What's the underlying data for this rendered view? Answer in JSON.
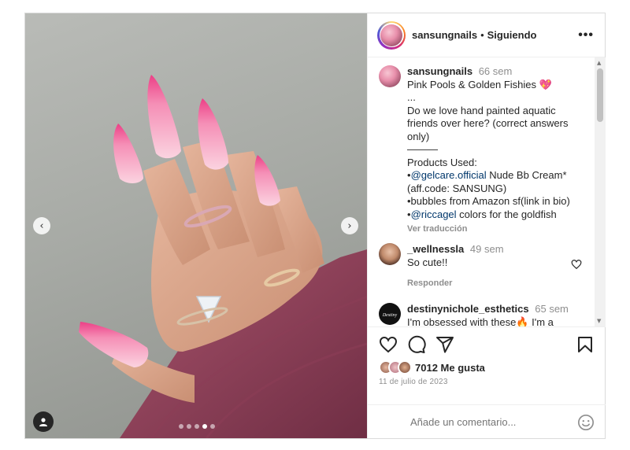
{
  "post": {
    "image_alt": "Hand with long pink almond nails",
    "carousel": {
      "total": 5,
      "active_index": 3
    },
    "nav_prev": "‹",
    "nav_next": "›"
  },
  "header": {
    "username": "sansungnails",
    "separator": "•",
    "follow_state": "Siguiendo",
    "more": "•••"
  },
  "caption": {
    "username": "sansungnails",
    "time": "66 sem",
    "title": "Pink Pools & Golden Fishies",
    "emoji": "💖",
    "lines": [
      "...",
      "Do we love hand painted aquatic",
      "friends over here? (correct answers",
      "only)",
      "———",
      "Products Used:"
    ],
    "product1_prefix": "•",
    "product1_mention": "@gelcare.official",
    "product1_rest": " Nude Bb Cream*",
    "product1_line2": "(aff.code: SANSUNG)",
    "product2": "•bubbles from Amazon sf(link in bio)",
    "product3_prefix": "•",
    "product3_mention": "@riccagel",
    "product3_rest": " colors for the goldfish",
    "see_translation": "Ver traducción"
  },
  "comments": [
    {
      "username": "_wellnessla",
      "time": "49 sem",
      "text": "So cute!!",
      "reply": "Responder"
    },
    {
      "username": "destinynichole_esthetics",
      "time": "65 sem",
      "text": "I'm obsessed with these🔥 I'm a"
    }
  ],
  "likes": {
    "text": "7012 Me gusta"
  },
  "date": "11 de julio de 2023",
  "add_comment": {
    "placeholder": "Añade un comentario..."
  },
  "icons": [
    "heart-icon",
    "comment-icon",
    "share-icon",
    "bookmark-icon",
    "emoji-icon",
    "user-tag-icon"
  ]
}
